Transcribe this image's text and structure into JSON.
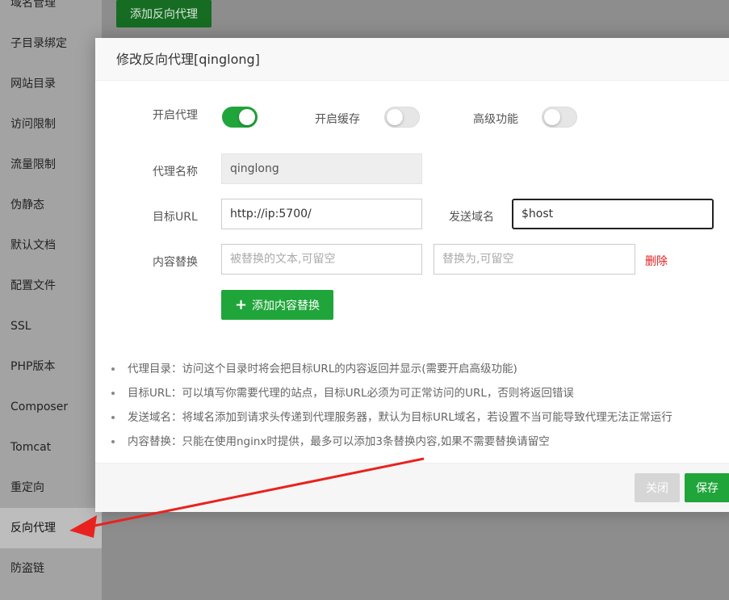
{
  "sidebar": {
    "items": [
      {
        "label": "域名管理"
      },
      {
        "label": "子目录绑定"
      },
      {
        "label": "网站目录"
      },
      {
        "label": "访问限制"
      },
      {
        "label": "流量限制"
      },
      {
        "label": "伪静态"
      },
      {
        "label": "默认文档"
      },
      {
        "label": "配置文件"
      },
      {
        "label": "SSL"
      },
      {
        "label": "PHP版本"
      },
      {
        "label": "Composer"
      },
      {
        "label": "Tomcat"
      },
      {
        "label": "重定向"
      },
      {
        "label": "反向代理"
      },
      {
        "label": "防盗链"
      }
    ],
    "active": "反向代理"
  },
  "background": {
    "add_button_label": "添加反向代理"
  },
  "dialog": {
    "title": "修改反向代理[qinglong]",
    "toggles": {
      "enable_proxy": {
        "label": "开启代理",
        "on": true
      },
      "enable_cache": {
        "label": "开启缓存",
        "on": false
      },
      "advanced": {
        "label": "高级功能",
        "on": false
      }
    },
    "proxy_name": {
      "label": "代理名称",
      "value": "qinglong"
    },
    "target_url": {
      "label": "目标URL",
      "value": "http://ip:5700/"
    },
    "send_domain": {
      "label": "发送域名",
      "value": "$host"
    },
    "content_replace": {
      "label": "内容替换",
      "from_placeholder": "被替换的文本,可留空",
      "to_placeholder": "替换为,可留空",
      "delete_label": "删除"
    },
    "add_replace_label": "添加内容替换",
    "tips": [
      "代理目录：访问这个目录时将会把目标URL的内容返回并显示(需要开启高级功能)",
      "目标URL：可以填写你需要代理的站点，目标URL必须为可正常访问的URL，否则将返回错误",
      "发送域名：将域名添加到请求头传递到代理服务器，默认为目标URL域名，若设置不当可能导致代理无法正常运行",
      "内容替换：只能在使用nginx时提供，最多可以添加3条替换内容,如果不需要替换请留空"
    ],
    "footer": {
      "close_label": "关闭",
      "save_label": "保存"
    }
  },
  "colors": {
    "accent": "#20a53a",
    "danger": "#e02020",
    "annotation_arrow": "#e8231f"
  }
}
